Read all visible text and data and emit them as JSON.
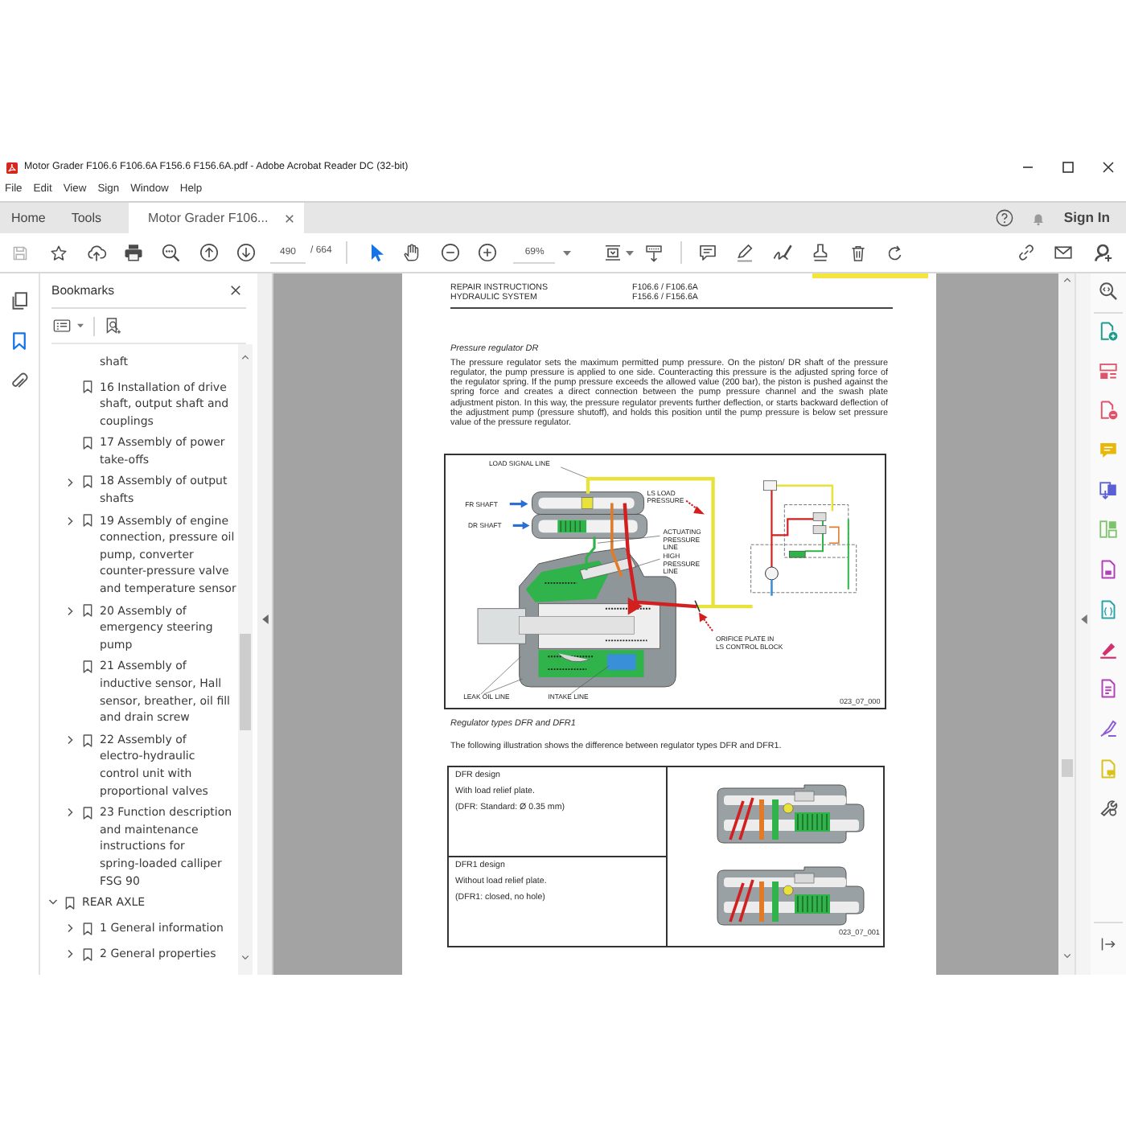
{
  "window": {
    "title": "Motor Grader F106.6 F106.6A F156.6 F156.6A.pdf - Adobe Acrobat Reader DC (32-bit)"
  },
  "menu": [
    "File",
    "Edit",
    "View",
    "Sign",
    "Window",
    "Help"
  ],
  "tabs": [
    {
      "label": "Home",
      "selected": false
    },
    {
      "label": "Tools",
      "selected": false
    },
    {
      "label": "Motor Grader F106...",
      "selected": true
    }
  ],
  "header_actions": {
    "sign_in": "Sign In"
  },
  "toolbar": {
    "page_field": "490",
    "page_count": "/ 664",
    "zoom_field": "69%",
    "tools": [
      {
        "kind": "select",
        "selected": true
      },
      {
        "kind": "hand",
        "selected": false
      }
    ]
  },
  "side_rail": [
    {
      "kind": "pages",
      "selected": false
    },
    {
      "kind": "bookmarks",
      "selected": true
    },
    {
      "kind": "attachments",
      "selected": false
    }
  ],
  "bookmarks": {
    "title": "Bookmarks",
    "tree": [
      {
        "children": [
          {
            "kind": "continued",
            "label": "shaft"
          },
          {
            "kind": "leaf",
            "label": "16 Installation of drive shaft, output shaft and couplings"
          },
          {
            "kind": "leaf",
            "label": "17 Assembly of power take-offs"
          },
          {
            "kind": "branch",
            "label": "18 Assembly of output shafts",
            "expanded": false
          },
          {
            "kind": "branch",
            "label": "19 Assembly of engine connection, pressure oil pump, converter counter-pressure valve and temperature sensor",
            "expanded": false
          },
          {
            "kind": "branch",
            "label": "20 Assembly of emergency steering pump",
            "expanded": false
          },
          {
            "kind": "leaf",
            "label": "21 Assembly of inductive sensor, Hall sensor, breather, oil fill and drain screw"
          },
          {
            "kind": "branch",
            "label": "22 Assembly of electro-hydraulic control unit with proportional valves",
            "expanded": false
          },
          {
            "kind": "branch",
            "label": "23 Function description and maintenance instructions for spring-loaded calliper FSG 90",
            "expanded": false
          }
        ]
      },
      {
        "kind": "branch",
        "label": "REAR AXLE",
        "expanded": true,
        "children": [
          {
            "kind": "branch",
            "label": "1 General information",
            "expanded": false
          },
          {
            "kind": "branch",
            "label": "2 General properties",
            "expanded": false
          }
        ]
      }
    ]
  },
  "document": {
    "running_header": [
      {
        "left": "REPAIR INSTRUCTIONS",
        "right": "F106.6 / F106.6A"
      },
      {
        "left": "HYDRAULIC SYSTEM",
        "right": "F156.6 / F156.6A"
      }
    ],
    "section_1": {
      "heading": "Pressure regulator DR",
      "paragraph": "The pressure regulator sets the maximum permitted pump pressure. On the piston/ DR shaft of the pressure regulator, the pump pressure is applied to one side. Counteracting this pressure is the adjusted spring force of the regulator spring. If the pump pressure exceeds the allowed value (200 bar), the piston is pushed against the spring force and creates a direct connection between the pump pressure channel and the swash plate adjustment piston. In this way, the pressure regulator prevents further deflection, or starts backward deflection of the adjustment pump (pressure shutoff), and holds this position until the pump pressure is below set pressure value of the pressure regulator.",
      "figure": {
        "labels": [
          {
            "lines": [
              "LOAD SIGNAL LINE"
            ]
          },
          {
            "lines": [
              "FR SHAFT"
            ]
          },
          {
            "lines": [
              "LS LOAD",
              "PRESSURE"
            ]
          },
          {
            "lines": [
              "DR SHAFT"
            ]
          },
          {
            "lines": [
              "ACTUATING",
              "PRESSURE",
              "LINE"
            ]
          },
          {
            "lines": [
              "HIGH",
              "PRESSURE",
              "LINE"
            ]
          },
          {
            "lines": [
              "ORIFICE PLATE IN",
              "LS CONTROL BLOCK"
            ]
          },
          {
            "lines": [
              "LEAK OIL LINE"
            ]
          },
          {
            "lines": [
              "INTAKE LINE"
            ]
          }
        ],
        "code": "023_07_000"
      }
    },
    "section_2": {
      "heading": "Regulator types DFR and DFR1",
      "paragraph": "The following illustration shows the difference between regulator types DFR and DFR1.",
      "table": {
        "rows": [
          {
            "title": "DFR design",
            "lines": [
              "With load relief plate.",
              "(DFR: Standard: Ø 0.35 mm)"
            ]
          },
          {
            "title": "DFR1 design",
            "lines": [
              "Without load relief plate.",
              "(DFR1: closed, no hole)"
            ]
          }
        ],
        "figure_code": "023_07_001"
      }
    }
  }
}
